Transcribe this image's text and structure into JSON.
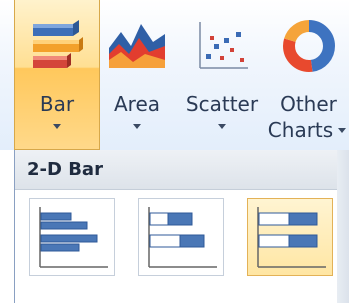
{
  "ribbon": {
    "buttons": [
      {
        "label": "Bar",
        "selected": true,
        "icon": "bar-chart-icon"
      },
      {
        "label": "Area",
        "selected": false,
        "icon": "area-chart-icon"
      },
      {
        "label": "Scatter",
        "selected": false,
        "icon": "scatter-chart-icon"
      },
      {
        "label_line1": "Other",
        "label_line2": "Charts",
        "selected": false,
        "icon": "donut-chart-icon"
      }
    ]
  },
  "panel": {
    "heading": "2-D Bar",
    "thumbnails": [
      {
        "icon": "clustered-bar-icon",
        "selected": false
      },
      {
        "icon": "stacked-bar-icon",
        "selected": false
      },
      {
        "icon": "100-stacked-bar-icon",
        "selected": true
      }
    ]
  },
  "colors": {
    "accent": "#ffc85c",
    "bar_blue": "#4a77b6",
    "bar_orange": "#f08a1a"
  }
}
